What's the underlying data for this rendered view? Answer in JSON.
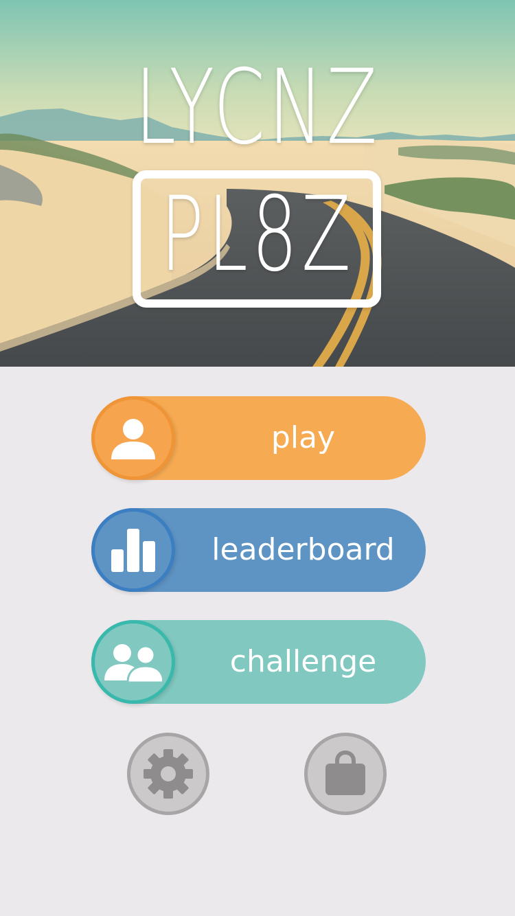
{
  "logo": {
    "line1": "LYCNZ",
    "line2": "PL8Z"
  },
  "menu": {
    "play": {
      "label": "play",
      "icon": "person-icon",
      "color": "#f6aa52"
    },
    "leaderboard": {
      "label": "leaderboard",
      "icon": "bar-chart-icon",
      "color": "#5e94c4"
    },
    "challenge": {
      "label": "challenge",
      "icon": "two-people-icon",
      "color": "#80c8c0"
    }
  },
  "footer": {
    "settings": {
      "icon": "gear-icon"
    },
    "shop": {
      "icon": "shopping-bag-icon"
    }
  },
  "colors": {
    "background": "#ece9ec",
    "round_button": "#cbc9ca",
    "round_button_border": "#a8a5a6",
    "icon_gray": "#8f8c8d"
  }
}
